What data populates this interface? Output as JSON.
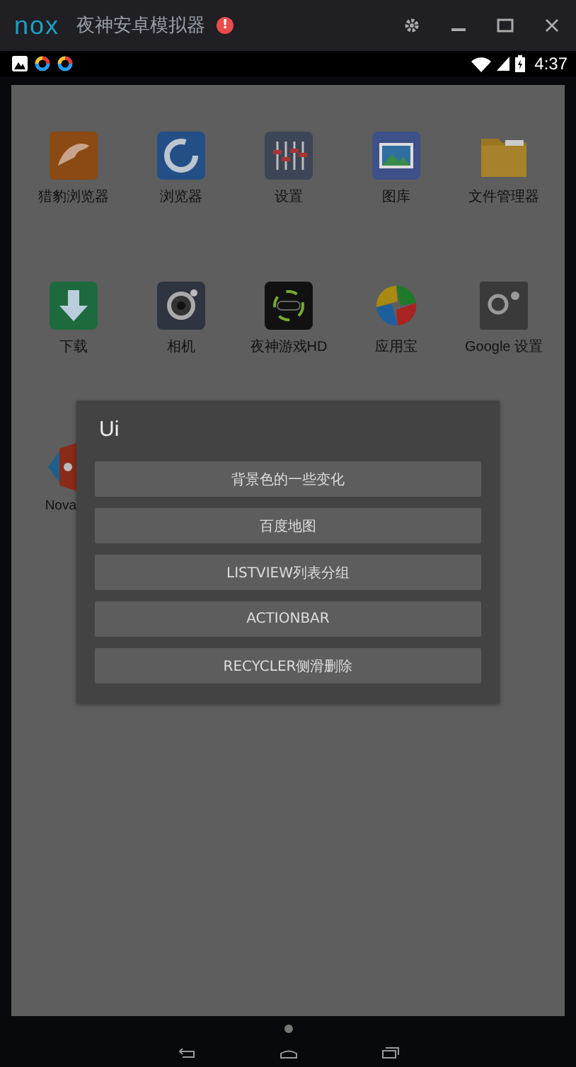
{
  "window": {
    "logo": "nox",
    "title": "夜神安卓模拟器",
    "alert": "!"
  },
  "status_bar": {
    "time": "4:37"
  },
  "apps": [
    {
      "label": "猎豹浏览器"
    },
    {
      "label": "浏览器"
    },
    {
      "label": "设置"
    },
    {
      "label": "图库"
    },
    {
      "label": "文件管理器"
    },
    {
      "label": "下载"
    },
    {
      "label": "相机"
    },
    {
      "label": "夜神游戏HD"
    },
    {
      "label": "应用宝"
    },
    {
      "label": "Google 设置"
    }
  ],
  "partial_app": {
    "label": "Nova"
  },
  "dialog": {
    "title": "Ui",
    "buttons": [
      "背景色的一些变化",
      "百度地图",
      "LISTVIEW列表分组",
      "ACTIONBAR",
      "RECYCLER侧滑删除"
    ]
  }
}
